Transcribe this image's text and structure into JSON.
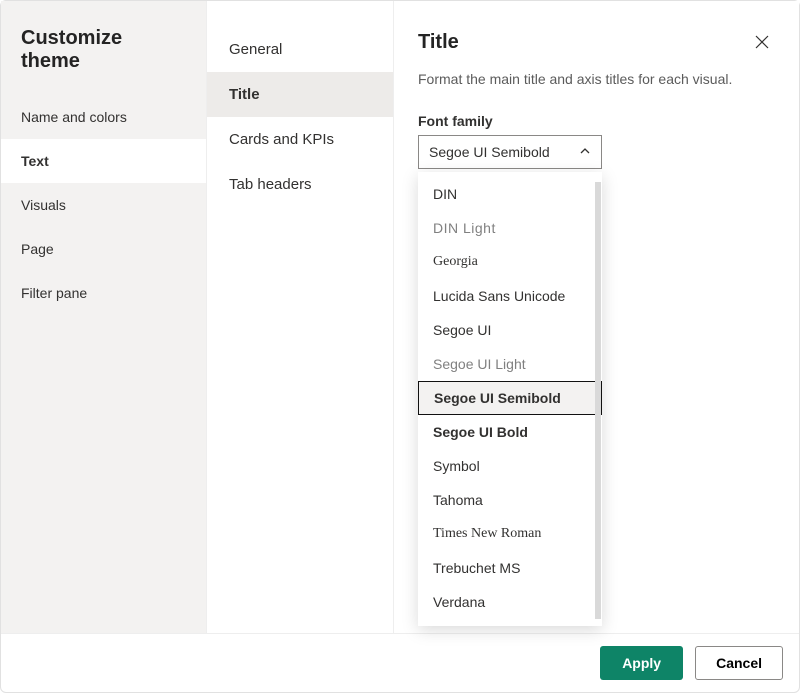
{
  "header": {
    "title": "Customize theme"
  },
  "nav": {
    "items": [
      {
        "label": "Name and colors",
        "active": false
      },
      {
        "label": "Text",
        "active": true
      },
      {
        "label": "Visuals",
        "active": false
      },
      {
        "label": "Page",
        "active": false
      },
      {
        "label": "Filter pane",
        "active": false
      }
    ]
  },
  "subnav": {
    "items": [
      {
        "label": "General",
        "active": false
      },
      {
        "label": "Title",
        "active": true
      },
      {
        "label": "Cards and KPIs",
        "active": false
      },
      {
        "label": "Tab headers",
        "active": false
      }
    ]
  },
  "pane": {
    "title": "Title",
    "description": "Format the main title and axis titles for each visual.",
    "field_label": "Font family",
    "selected_font": "Segoe UI Semibold",
    "font_options": [
      {
        "label": "DIN",
        "cls": "f-din"
      },
      {
        "label": "DIN Light",
        "cls": "f-din-light"
      },
      {
        "label": "Georgia",
        "cls": "f-georgia"
      },
      {
        "label": "Lucida Sans Unicode",
        "cls": "f-lucida"
      },
      {
        "label": "Segoe UI",
        "cls": "f-segoe"
      },
      {
        "label": "Segoe UI Light",
        "cls": "f-segoe-light"
      },
      {
        "label": "Segoe UI Semibold",
        "cls": "f-segoe-sb",
        "selected": true
      },
      {
        "label": "Segoe UI Bold",
        "cls": "f-segoe-bold"
      },
      {
        "label": "Symbol",
        "cls": "f-symbol"
      },
      {
        "label": "Tahoma",
        "cls": "f-tahoma"
      },
      {
        "label": "Times New Roman",
        "cls": "f-times"
      },
      {
        "label": "Trebuchet MS",
        "cls": "f-trebuchet"
      },
      {
        "label": "Verdana",
        "cls": "f-verdana"
      }
    ]
  },
  "buttons": {
    "apply": "Apply",
    "cancel": "Cancel"
  }
}
